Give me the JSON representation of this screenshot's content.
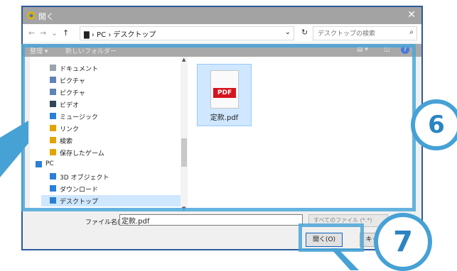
{
  "window": {
    "title": "開く",
    "close_glyph": "✕"
  },
  "address": {
    "back": "←",
    "forward": "→",
    "recent": "⌄",
    "up": "↑",
    "breadcrumb": "▇ › PC › デスクトップ",
    "dropdown": "⌄",
    "refresh": "↻",
    "search_placeholder": "デスクトップの検索",
    "search_icon": "⌕"
  },
  "toolbar": {
    "organize": "整理 ▾",
    "new_folder": "新しいフォルダー",
    "view_glyph": "▤ ▾",
    "pane_glyph": "◫",
    "help_glyph": "?"
  },
  "nav_items": [
    {
      "label": "ドキュメント",
      "icon": "document-icon",
      "color": "#9aa3ad"
    },
    {
      "label": "ピクチャ",
      "icon": "picture-icon",
      "color": "#5e83b6"
    },
    {
      "label": "ピクチャ",
      "icon": "picture-icon",
      "color": "#5e83b6"
    },
    {
      "label": "ビデオ",
      "icon": "video-icon",
      "color": "#30465c"
    },
    {
      "label": "ミュージック",
      "icon": "music-icon",
      "color": "#2b7fd6"
    },
    {
      "label": "リンク",
      "icon": "link-icon",
      "color": "#e2a400"
    },
    {
      "label": "検索",
      "icon": "search-folder-icon",
      "color": "#e2a400"
    },
    {
      "label": "保存したゲーム",
      "icon": "games-icon",
      "color": "#e2a400"
    },
    {
      "label": "PC",
      "icon": "pc-icon",
      "color": "#2b7fd6"
    },
    {
      "label": "3D オブジェクト",
      "icon": "3d-objects-icon",
      "color": "#2b7fd6"
    },
    {
      "label": "ダウンロード",
      "icon": "download-icon",
      "color": "#2b7fd6"
    },
    {
      "label": "デスクトップ",
      "icon": "desktop-icon",
      "color": "#2b7fd6"
    }
  ],
  "file": {
    "name": "定款.pdf",
    "badge": "PDF"
  },
  "footer": {
    "filename_label": "ファイル名(N):",
    "filename_value": "定款.pdf",
    "filter_value": "すべてのファイル (*.*)",
    "open_button": "開く(O)",
    "cancel_button": "キャンセル"
  },
  "steps": {
    "six": "6",
    "seven": "7"
  },
  "colors": {
    "accent": "#46a1d5",
    "frame": "#2c5a9a",
    "selection": "#cfe7ff",
    "pdf_red": "#d6141e"
  }
}
